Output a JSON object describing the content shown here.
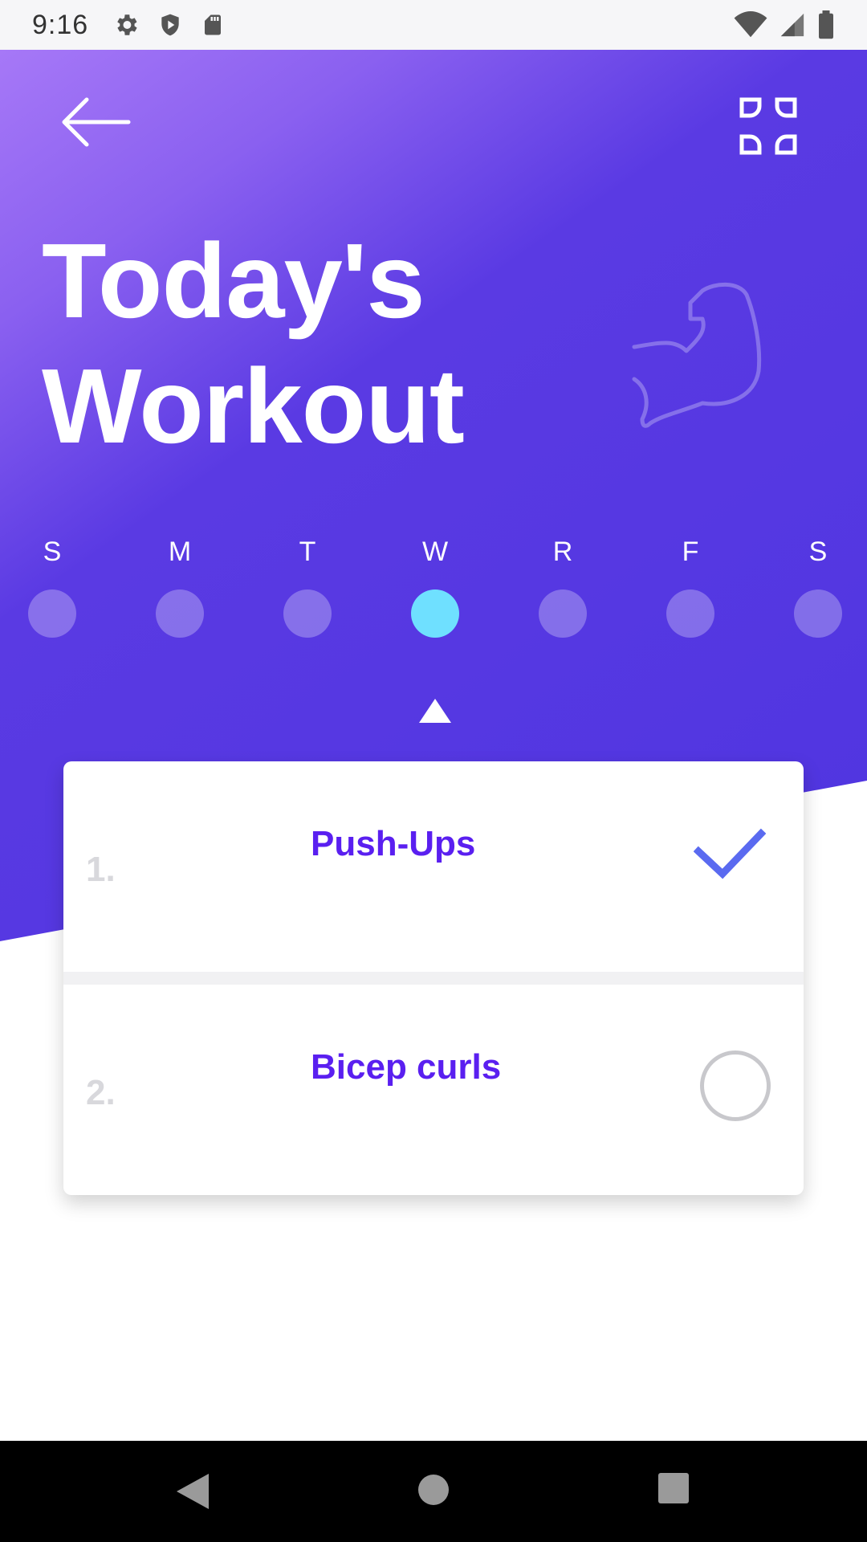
{
  "status_bar": {
    "time": "9:16",
    "icons_left": [
      "gear-icon",
      "shield-icon",
      "sd-card-icon"
    ],
    "icons_right": [
      "wifi-icon",
      "signal-icon",
      "battery-icon"
    ]
  },
  "header": {
    "title_line1": "Today's",
    "title_line2": "Workout",
    "back_icon": "arrow-left-icon",
    "menu_icon": "grid-icon",
    "decor_icon": "bicep-icon"
  },
  "days": [
    {
      "label": "S",
      "active": false
    },
    {
      "label": "M",
      "active": false
    },
    {
      "label": "T",
      "active": false
    },
    {
      "label": "W",
      "active": true
    },
    {
      "label": "R",
      "active": false
    },
    {
      "label": "F",
      "active": false
    },
    {
      "label": "S",
      "active": false
    }
  ],
  "workouts": [
    {
      "number": "1.",
      "name": "Push-Ups",
      "done": true
    },
    {
      "number": "2.",
      "name": "Bicep curls",
      "done": false
    }
  ],
  "colors": {
    "accent": "#5a1ff0",
    "gradient_start": "#a678f7",
    "gradient_end": "#4f35e0",
    "active_day": "#6fe0ff",
    "check": "#5a6af0"
  },
  "nav_bar": {
    "icons": [
      "nav-back-icon",
      "nav-home-icon",
      "nav-recents-icon"
    ]
  }
}
